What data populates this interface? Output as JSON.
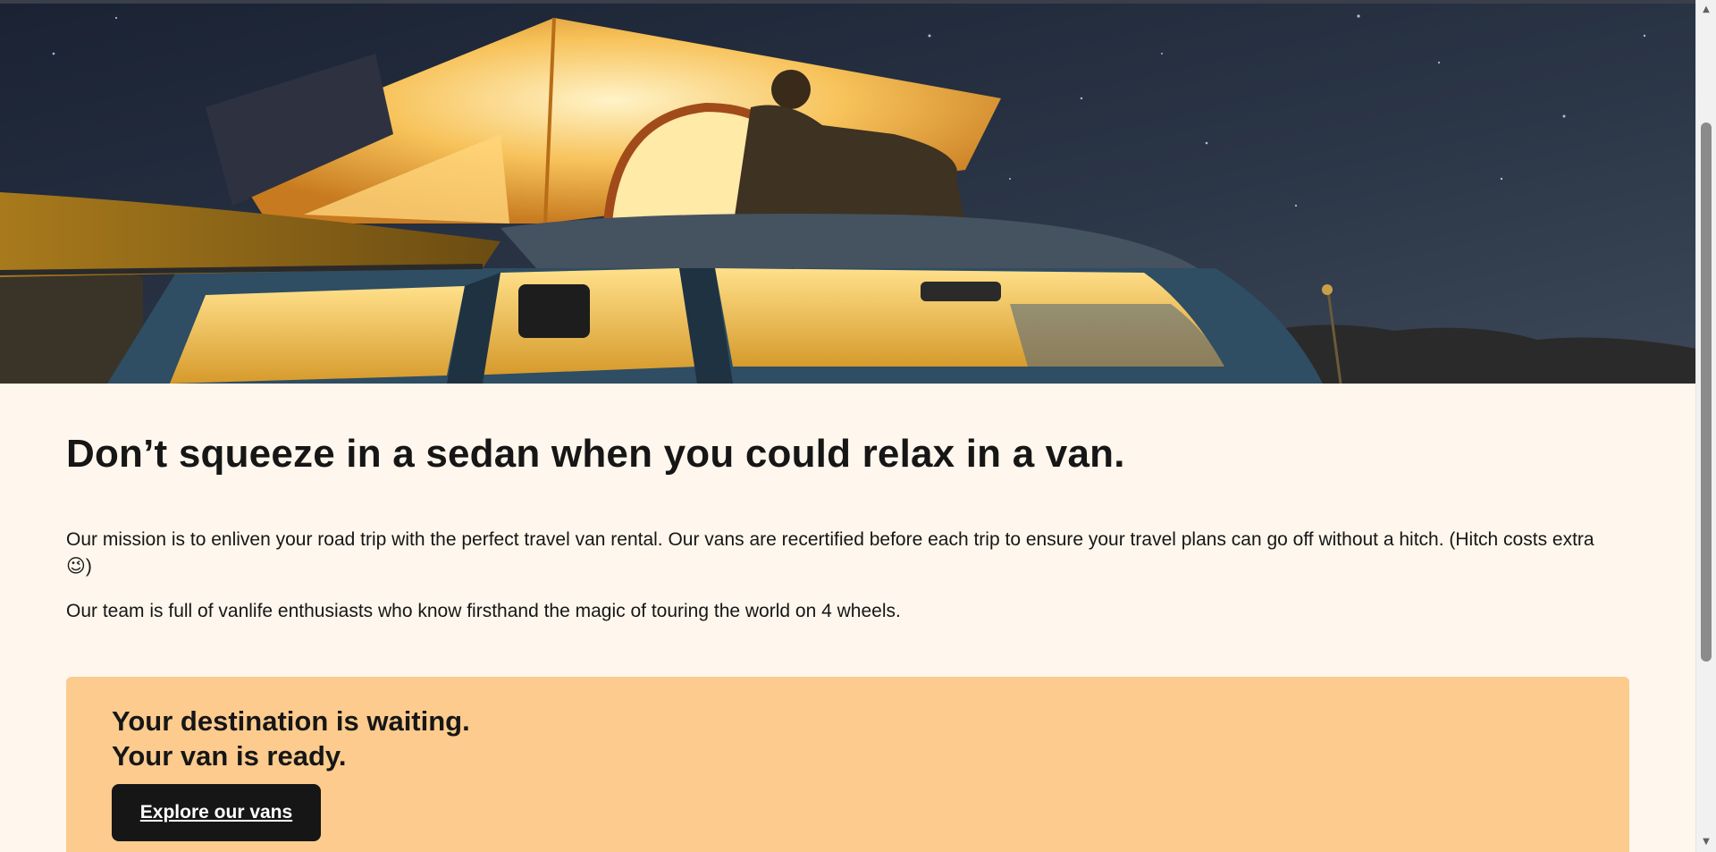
{
  "hero": {
    "image_icon": "van-night-camping-image"
  },
  "main": {
    "headline": "Don’t squeeze in a sedan when you could relax in a van.",
    "paragraph_1": "Our mission is to enliven your road trip with the perfect travel van rental. Our vans are recertified before each trip to ensure your travel plans can go off without a hitch. (Hitch costs extra 😉)",
    "paragraph_2": "Our team is full of vanlife enthusiasts who know firsthand the magic of touring the world on 4 wheels."
  },
  "cta": {
    "line_1": "Your destination is waiting.",
    "line_2": "Your van is ready.",
    "button_label": "Explore our vans"
  },
  "colors": {
    "page_background": "#FFF7ED",
    "cta_background": "#FCCB8D",
    "button_background": "#161616",
    "text": "#161616"
  },
  "scrollbar": {
    "up_icon": "triangle-up-icon",
    "down_icon": "triangle-down-icon"
  }
}
